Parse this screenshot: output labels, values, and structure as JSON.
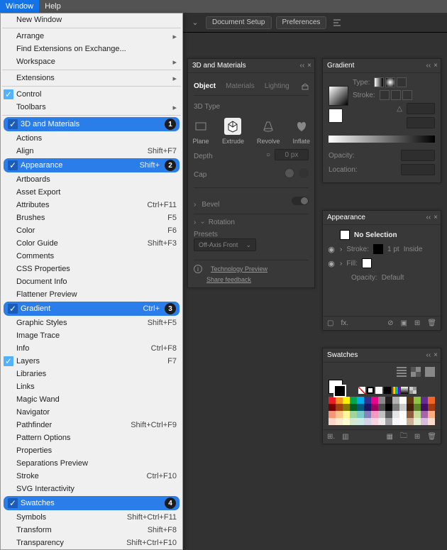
{
  "menubar": {
    "items": [
      "Window",
      "Help"
    ],
    "selected": 0
  },
  "appbar": {
    "doc_setup": "Document Setup",
    "prefs": "Preferences"
  },
  "window_menu": {
    "new_window": "New Window",
    "arrange": "Arrange",
    "find_ext": "Find Extensions on Exchange...",
    "workspace": "Workspace",
    "extensions": "Extensions",
    "control": "Control",
    "toolbars": "Toolbars",
    "hl1": {
      "label": "3D and Materials",
      "badge": "1"
    },
    "actions": "Actions",
    "align": {
      "label": "Align",
      "sc": "Shift+F7"
    },
    "hl2": {
      "label": "Appearance",
      "sc": "Shift+",
      "badge": "2"
    },
    "artboards": "Artboards",
    "asset_export": "Asset Export",
    "attributes": {
      "label": "Attributes",
      "sc": "Ctrl+F11"
    },
    "brushes": {
      "label": "Brushes",
      "sc": "F5"
    },
    "color": {
      "label": "Color",
      "sc": "F6"
    },
    "color_guide": {
      "label": "Color Guide",
      "sc": "Shift+F3"
    },
    "comments": "Comments",
    "css_props": "CSS Properties",
    "doc_info": "Document Info",
    "flattener": "Flattener Preview",
    "hl3": {
      "label": "Gradient",
      "sc": "Ctrl+",
      "badge": "3"
    },
    "graphic_styles": {
      "label": "Graphic Styles",
      "sc": "Shift+F5"
    },
    "image_trace": "Image Trace",
    "info": {
      "label": "Info",
      "sc": "Ctrl+F8"
    },
    "layers": {
      "label": "Layers",
      "sc": "F7"
    },
    "libraries": "Libraries",
    "links": "Links",
    "magic_wand": "Magic Wand",
    "navigator": "Navigator",
    "pathfinder": {
      "label": "Pathfinder",
      "sc": "Shift+Ctrl+F9"
    },
    "pattern_opts": "Pattern Options",
    "properties": "Properties",
    "seps": "Separations Preview",
    "stroke": {
      "label": "Stroke",
      "sc": "Ctrl+F10"
    },
    "svg": "SVG Interactivity",
    "hl4": {
      "label": "Swatches",
      "badge": "4"
    },
    "symbols": {
      "label": "Symbols",
      "sc": "Shift+Ctrl+F11"
    },
    "transform": {
      "label": "Transform",
      "sc": "Shift+F8"
    },
    "transparency": {
      "label": "Transparency",
      "sc": "Shift+Ctrl+F10"
    }
  },
  "panel_3d": {
    "title": "3D and Materials",
    "tabs": [
      "Object",
      "Materials",
      "Lighting"
    ],
    "sect_type": "3D Type",
    "types": [
      "Plane",
      "Extrude",
      "Revolve",
      "Inflate"
    ],
    "depth_label": "Depth",
    "depth_val": "0 px",
    "cap_label": "Cap",
    "bevel": "Bevel",
    "rotation": "Rotation",
    "presets": "Presets",
    "preset_val": "Off-Axis Front",
    "tech": "Technology Preview",
    "share": "Share feedback"
  },
  "panel_grad": {
    "title": "Gradient",
    "type": "Type:",
    "stroke": "Stroke:",
    "opacity": "Opacity:",
    "location": "Location:"
  },
  "panel_app": {
    "title": "Appearance",
    "nosel": "No Selection",
    "stroke": "Stroke:",
    "stroke_val": "1 pt",
    "stroke_pos": "Inside",
    "fill": "Fill:",
    "opacity": "Opacity:",
    "opacity_val": "Default",
    "fx": "fx."
  },
  "panel_sw": {
    "title": "Swatches"
  },
  "chart_data": null
}
